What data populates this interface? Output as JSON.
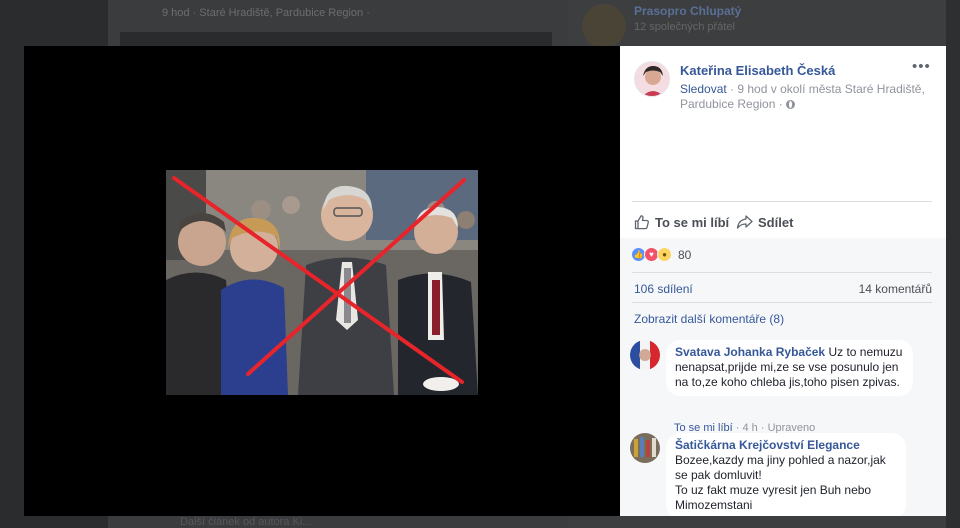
{
  "background": {
    "post_meta": "9 hod · Staré Hradiště, Pardubice Region · ",
    "right_name": "Prasopro Chlupatý",
    "right_sub": "12 společných přátel",
    "bottom_text": "Další článek od autora Ki..."
  },
  "post": {
    "author": "Kateřina Elisabeth Česká",
    "follow_label": "Sledovat",
    "meta": " · 9 hod v okolí města Staré Hradiště, Pardubice Region · ",
    "more_icon": "more-dots-icon"
  },
  "actions": {
    "like_label": "To se mi líbí",
    "share_label": "Sdílet"
  },
  "stats": {
    "reaction_count": "80",
    "reactions": [
      "like",
      "love",
      "wow"
    ],
    "shares": "106 sdílení",
    "comments": "14 komentářů",
    "more_comments": "Zobrazit další komentáře (8)"
  },
  "comments": [
    {
      "author": "Svatava Johanka Rybaček",
      "text": "Uz to nemuzu nenapsat,prijde mi,ze se vse posunulo jen na to,ze koho chleba jis,toho pisen zpivas.",
      "like_label": "To se mi líbí",
      "time": "4 h",
      "edited": "Upraveno"
    },
    {
      "author": "Šatičkárna Krejčovství Elegance",
      "text": "Bozee,kazdy ma jiny pohled a nazor,jak se pak domluvit!\nTo uz fakt muze vyresit jen Buh nebo Mimozemstani"
    }
  ],
  "colors": {
    "link": "#365899",
    "muted": "#90949c",
    "cross": "#e8242b"
  }
}
